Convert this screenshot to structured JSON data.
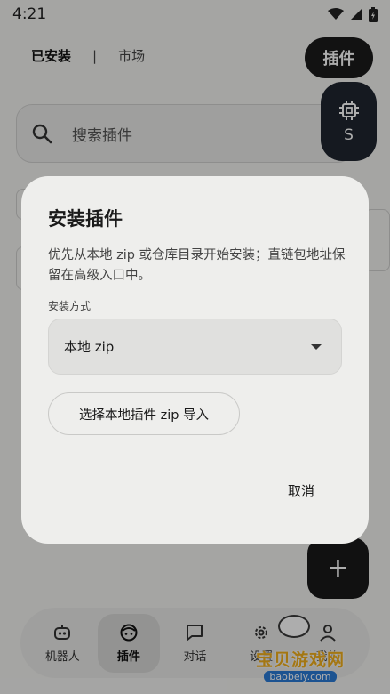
{
  "status_bar": {
    "time": "4:21"
  },
  "header": {
    "tab_installed": "已安装",
    "separator": "|",
    "tab_market": "市场",
    "plugin_button": "插件"
  },
  "search": {
    "placeholder": "搜索插件"
  },
  "side_fab": {
    "label": "S",
    "icon": "chip-icon"
  },
  "add_fab": {
    "label": "+"
  },
  "bottom_nav": {
    "items": [
      {
        "label": "机器人",
        "icon": "robot-icon",
        "active": false
      },
      {
        "label": "插件",
        "icon": "plugin-face-icon",
        "active": true
      },
      {
        "label": "对话",
        "icon": "chat-icon",
        "active": false
      },
      {
        "label": "设置",
        "icon": "gear-icon",
        "active": false
      },
      {
        "label": "我的",
        "icon": "person-icon",
        "active": false
      }
    ]
  },
  "watermark": {
    "text": "宝贝游戏网",
    "url": "baobeiy.com"
  },
  "dialog": {
    "title": "安装插件",
    "description": "优先从本地 zip 或仓库目录开始安装；直链包地址保留在高级入口中。",
    "method_label": "安装方式",
    "method_value": "本地 zip",
    "import_button": "选择本地插件 zip 导入",
    "cancel_button": "取消"
  },
  "colors": {
    "background": "#f3f3f1",
    "dialog": "#eeeeec",
    "dark_button": "#1b1b1b",
    "scrim": "rgba(0,0,0,0.32)"
  }
}
